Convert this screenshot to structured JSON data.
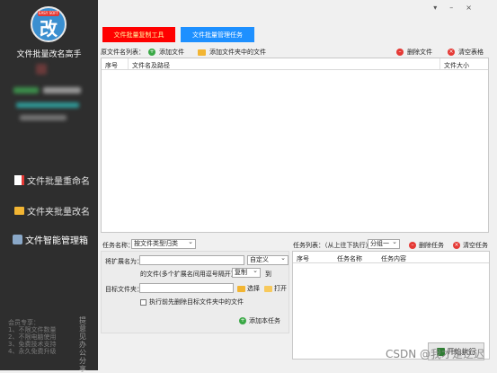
{
  "sidebar": {
    "app_icon_tag": "EASY SOFT",
    "app_icon_glyph": "改",
    "app_name": "文件批量改名高手",
    "nav": [
      {
        "label": "文件批量重命名",
        "icon": "document-icon"
      },
      {
        "label": "文件夹批量改名",
        "icon": "folder-icon"
      },
      {
        "label": "文件智能管理箱",
        "icon": "toolbox-icon"
      }
    ],
    "promo_title": "会员专享：",
    "promo_lines": [
      "1、不限文件数量",
      "2、不限电脑使用",
      "3、免费技术支持",
      "4、永久免费升级"
    ],
    "feedback": "提意见办公分享"
  },
  "window_controls": {
    "menu": "▾",
    "minimize": "–",
    "close": "×"
  },
  "tabs": [
    {
      "label": "文件批量复制工具",
      "active": true,
      "color": "#ff0000"
    },
    {
      "label": "文件批量管理任务",
      "active": false,
      "color": "#1e90ff"
    }
  ],
  "toolbar": {
    "list_label": "原文件名列表：",
    "add_file": "添加文件",
    "add_folder_files": "添加文件夹中的文件",
    "delete_file": "删除文件",
    "clear_table": "清空表格"
  },
  "file_table": {
    "columns": [
      "序号",
      "文件名及路径",
      "文件大小"
    ],
    "rows": []
  },
  "task_form": {
    "task_name_label": "任务名称：",
    "task_name_value": "按文件类型归类",
    "ext_label": "将扩展名为：",
    "ext_value": "",
    "ext_mode": "自定义",
    "ext_hint": "的文件(多个扩展名间用逗号隔开)",
    "action_value": "复制",
    "action_suffix": "到",
    "target_label": "目标文件夹：",
    "target_value": "",
    "select_btn": "选择",
    "open_btn": "打开",
    "clear_checkbox_label": "执行前先删除目标文件夹中的文件",
    "add_task_btn": "添加本任务"
  },
  "task_list": {
    "label": "任务列表：（从上往下执行）",
    "group_value": "分组一",
    "delete_task": "删除任务",
    "clear_tasks": "清空任务",
    "columns": [
      "序号",
      "任务名称",
      "任务内容"
    ],
    "rows": []
  },
  "run_button": "开始执行",
  "watermark": "CSDN @我才是逆迟"
}
